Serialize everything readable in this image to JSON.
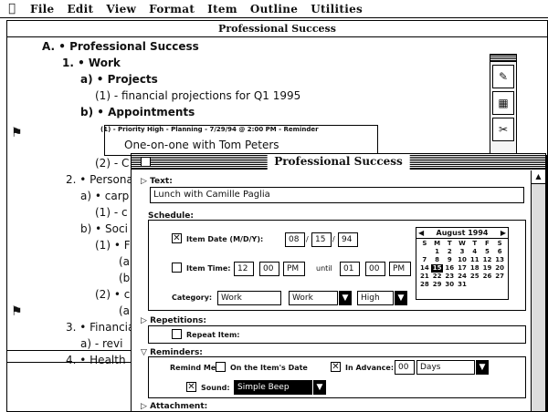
{
  "menubar": {
    "apple_icon": "apple-icon",
    "items": [
      "File",
      "Edit",
      "View",
      "Format",
      "Item",
      "Outline",
      "Utilities"
    ]
  },
  "main_window": {
    "title": "Professional Success",
    "outline": [
      {
        "text": "A. • Professional Success",
        "level": 0
      },
      {
        "text": "1. • Work",
        "level": 1
      },
      {
        "text": "a) • Projects",
        "level": 2
      },
      {
        "text": "(1) - financial projections for Q1 1995",
        "level": 3
      },
      {
        "text": "b) • Appointments",
        "level": 2
      },
      {
        "text": "(1) - Priority High - Planning - 7/29/94 @ 2:00 PM - Reminder",
        "level": 3
      },
      {
        "text": "One-on-one with Tom Peters",
        "level": 4
      },
      {
        "text": "(2) - C",
        "level": 3
      },
      {
        "text": "2. • Persona",
        "level": 1
      },
      {
        "text": "a) • carp",
        "level": 2
      },
      {
        "text": "(1) - c",
        "level": 3
      },
      {
        "text": "b) • Soci",
        "level": 2
      },
      {
        "text": "(1) • F",
        "level": 3
      },
      {
        "text": "(a",
        "level": 4
      },
      {
        "text": "(b",
        "level": 4
      },
      {
        "text": "(2) • c",
        "level": 3
      },
      {
        "text": "(a",
        "level": 4
      },
      {
        "text": "3. • Financia",
        "level": 1
      },
      {
        "text": "a) - revi",
        "level": 2
      },
      {
        "text": "4. • Health",
        "level": 1
      }
    ]
  },
  "dialog": {
    "title": "Professional Success",
    "text_section": "Text:",
    "text_value": "Lunch with Camille Paglia",
    "schedule_section": "Schedule:",
    "item_date_label": "Item Date (M/D/Y):",
    "date": {
      "month": "08",
      "day": "15",
      "year": "94"
    },
    "item_time_label": "Item Time:",
    "time": {
      "hour": "12",
      "minute": "00",
      "ampm": "PM"
    },
    "until_label": "until",
    "until_time": {
      "hour": "01",
      "minute": "00",
      "ampm": "PM"
    },
    "category_label": "Category:",
    "category_value": "Work",
    "category_value2": "Work",
    "priority_value": "High",
    "calendar": {
      "month": "August 1994",
      "weekdays": [
        "S",
        "M",
        "T",
        "W",
        "T",
        "F",
        "S"
      ],
      "weeks": [
        [
          "",
          "1",
          "2",
          "3",
          "4",
          "5",
          "6"
        ],
        [
          "7",
          "8",
          "9",
          "10",
          "11",
          "12",
          "13"
        ],
        [
          "14",
          "15",
          "16",
          "17",
          "18",
          "19",
          "20"
        ],
        [
          "21",
          "22",
          "23",
          "24",
          "25",
          "26",
          "27"
        ],
        [
          "28",
          "29",
          "30",
          "31",
          "",
          "",
          ""
        ]
      ],
      "selected": "15"
    },
    "repetitions_section": "Repetitions:",
    "repeat_item_label": "Repeat Item:",
    "reminders_section": "Reminders:",
    "remind_me_label": "Remind Me:",
    "on_items_date_label": "On the Item's Date",
    "in_advance_label": "In Advance:",
    "advance_value": "00",
    "advance_unit": "Days",
    "sound_label": "Sound:",
    "sound_value": "Simple Beep",
    "attachment_section": "Attachment:"
  }
}
